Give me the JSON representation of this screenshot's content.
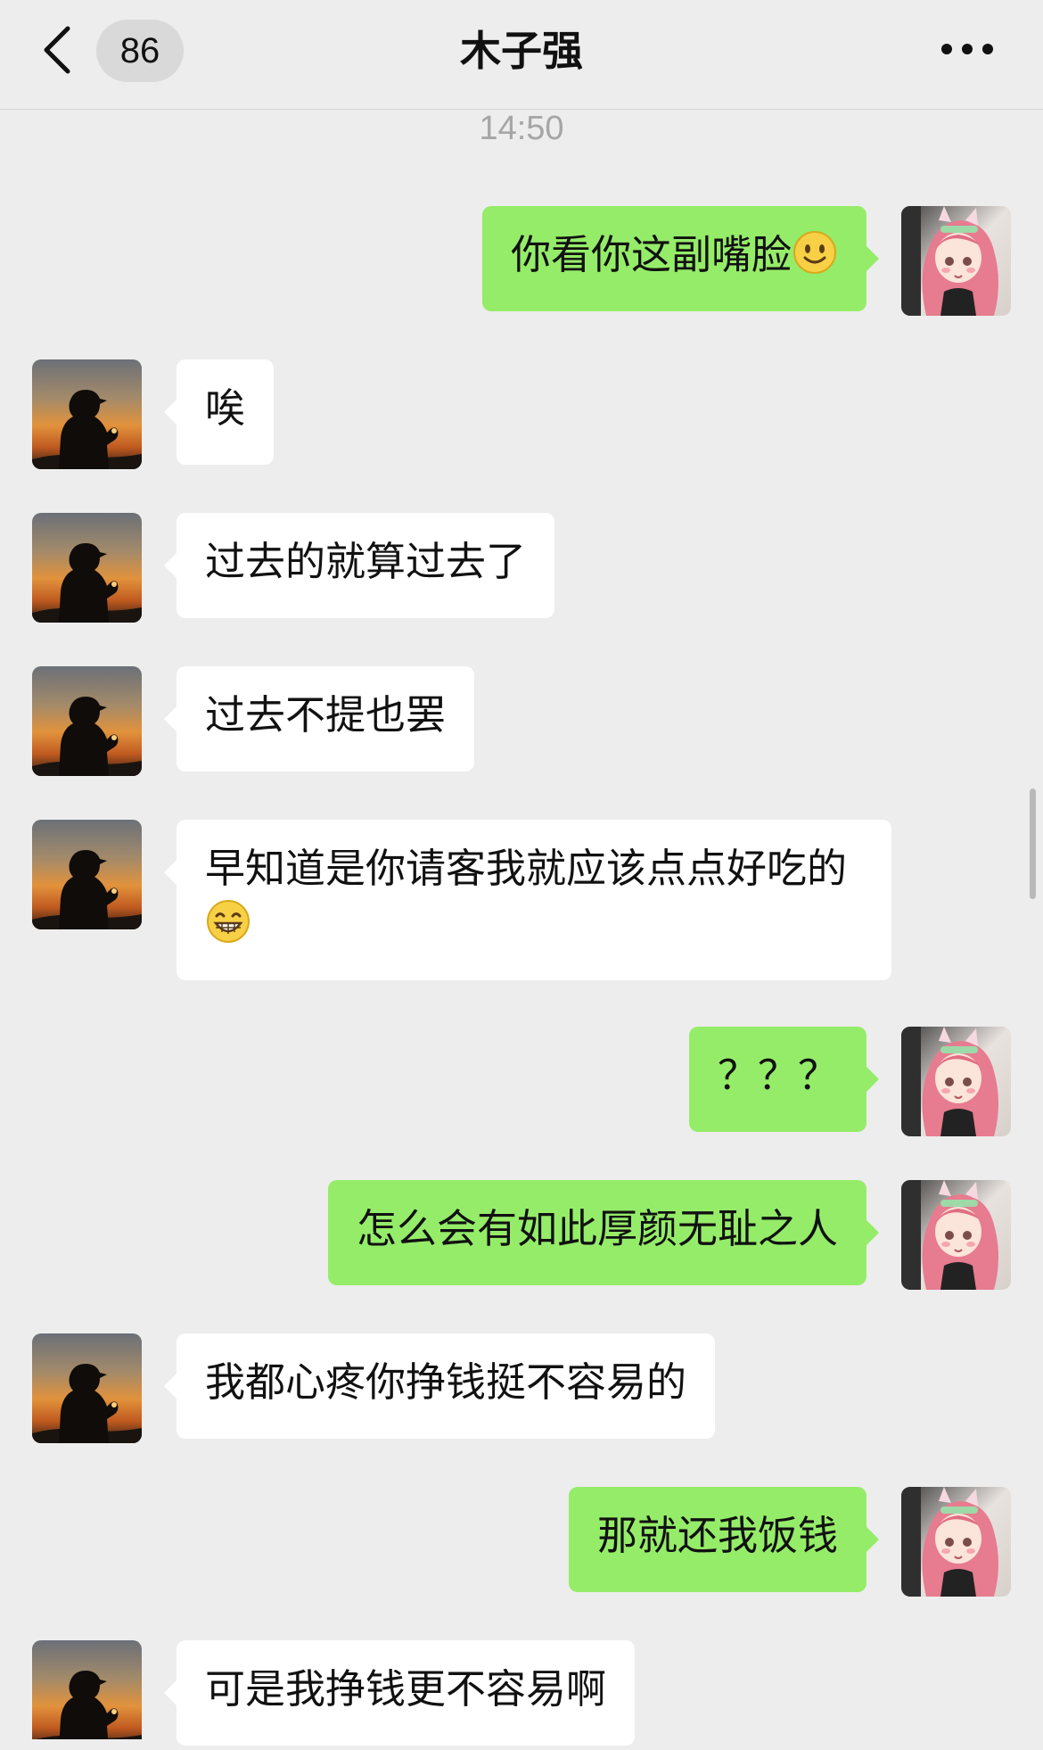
{
  "header": {
    "back_icon": "chevron-left-icon",
    "unread_count": "86",
    "title": "木子强",
    "more_icon": "ellipsis-icon"
  },
  "timestamp": "14:50",
  "messages": [
    {
      "side": "right",
      "text": "你看你这副嘴脸",
      "emoji": "smiling-face-emoji"
    },
    {
      "side": "left",
      "text": "唉"
    },
    {
      "side": "left",
      "text": "过去的就算过去了"
    },
    {
      "side": "left",
      "text": "过去不提也罢"
    },
    {
      "side": "left",
      "text": "早知道是你请客我就应该点点好吃的",
      "emoji": "grinning-face-emoji"
    },
    {
      "side": "right",
      "text": "？？？"
    },
    {
      "side": "right",
      "text": "怎么会有如此厚颜无耻之人"
    },
    {
      "side": "left",
      "text": "我都心疼你挣钱挺不容易的"
    },
    {
      "side": "right",
      "text": "那就还我饭钱"
    },
    {
      "side": "left",
      "text": "可是我挣钱更不容易啊"
    }
  ],
  "colors": {
    "background": "#ededed",
    "sent_bubble": "#95ec69",
    "received_bubble": "#ffffff"
  }
}
